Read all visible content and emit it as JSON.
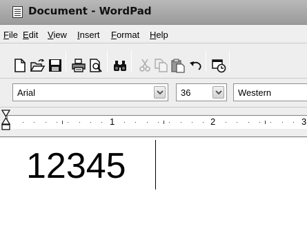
{
  "window": {
    "title": "Document - WordPad"
  },
  "menu": {
    "items": [
      "File",
      "Edit",
      "View",
      "Insert",
      "Format",
      "Help"
    ]
  },
  "toolbar": {
    "buttons": [
      "new-icon",
      "open-icon",
      "save-icon",
      "print-icon",
      "print-preview-icon",
      "find-icon",
      "cut-icon",
      "copy-icon",
      "paste-icon",
      "undo-icon",
      "date-time-icon"
    ]
  },
  "format_bar": {
    "font_name": "Arial",
    "font_size": "36",
    "script": "Western"
  },
  "ruler": {
    "numbers": [
      "1",
      "2",
      "3"
    ]
  },
  "document": {
    "text": "12345"
  }
}
